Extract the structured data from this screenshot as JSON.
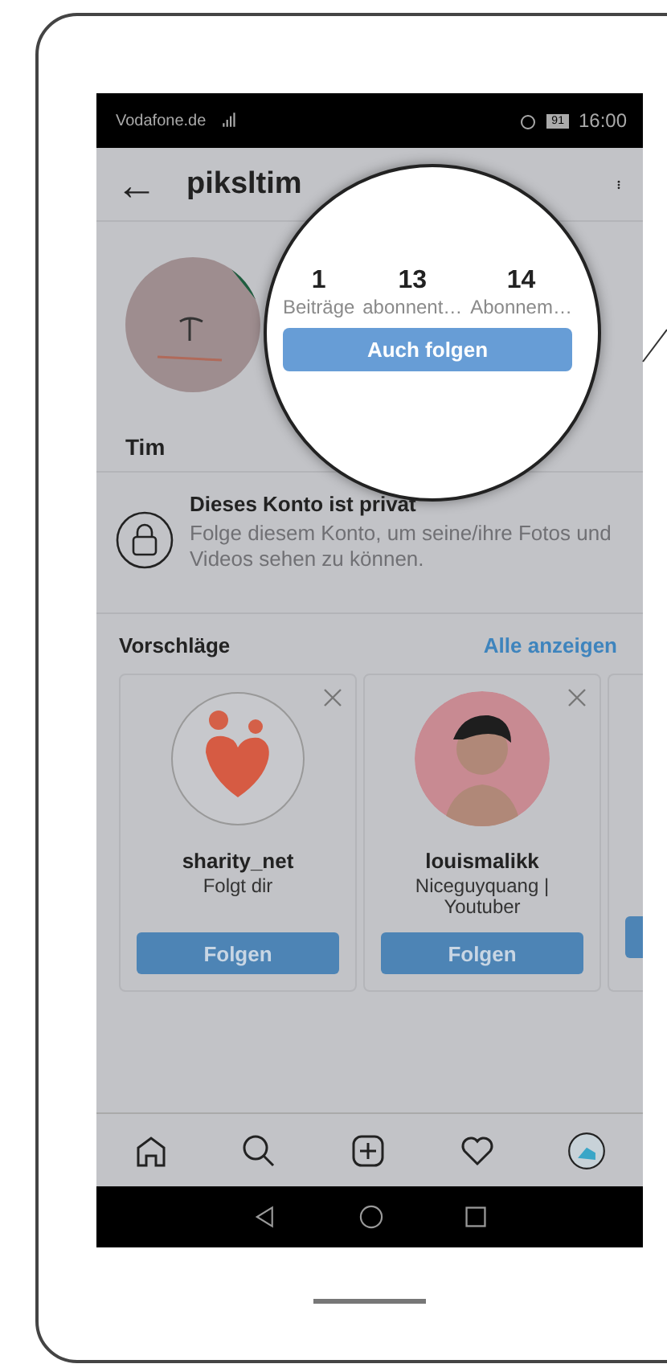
{
  "status_bar": {
    "carrier": "Vodafone.de",
    "battery": "91",
    "time": "16:00"
  },
  "header": {
    "title": "piksltim",
    "back": "←"
  },
  "profile": {
    "name": "Tim",
    "stats": [
      {
        "value": "1",
        "label": "Beiträge"
      },
      {
        "value": "13",
        "label": "abonnent…"
      },
      {
        "value": "14",
        "label": "Abonnem…"
      }
    ],
    "follow_button": "Auch folgen"
  },
  "private_notice": {
    "title": "Dieses Konto ist privat",
    "text": "Folge diesem Konto, um seine/ihre Fotos und Videos sehen zu können."
  },
  "suggestions": {
    "title": "Vorschläge",
    "see_all": "Alle anzeigen",
    "cards": [
      {
        "kind": "logo",
        "name": "sharity_net",
        "subtitle": "Folgt dir",
        "button": "Folgen"
      },
      {
        "kind": "person",
        "name": "louismalikk",
        "subtitle": "Niceguyquang | Youtuber",
        "button": "Folgen"
      }
    ]
  }
}
